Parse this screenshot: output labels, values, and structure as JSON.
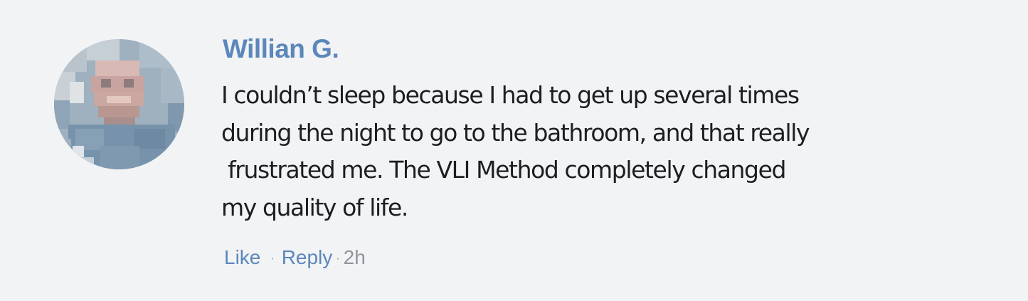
{
  "comment": {
    "author": "Willian G.",
    "lines": [
      "I couldn’t sleep because I had to get up several times",
      "during the night to go to the bathroom, and that really",
      " frustrated me. The VLI Method completely changed",
      "my quality of life."
    ],
    "actions": {
      "like": "Like",
      "reply": "Reply",
      "separator": "·",
      "time": "2h"
    },
    "colors": {
      "author": "#5b87bb",
      "text": "#1c1e21",
      "meta": "#90949c",
      "background": "#f2f3f5"
    },
    "avatar_icon": "pixelated-profile-photo"
  }
}
